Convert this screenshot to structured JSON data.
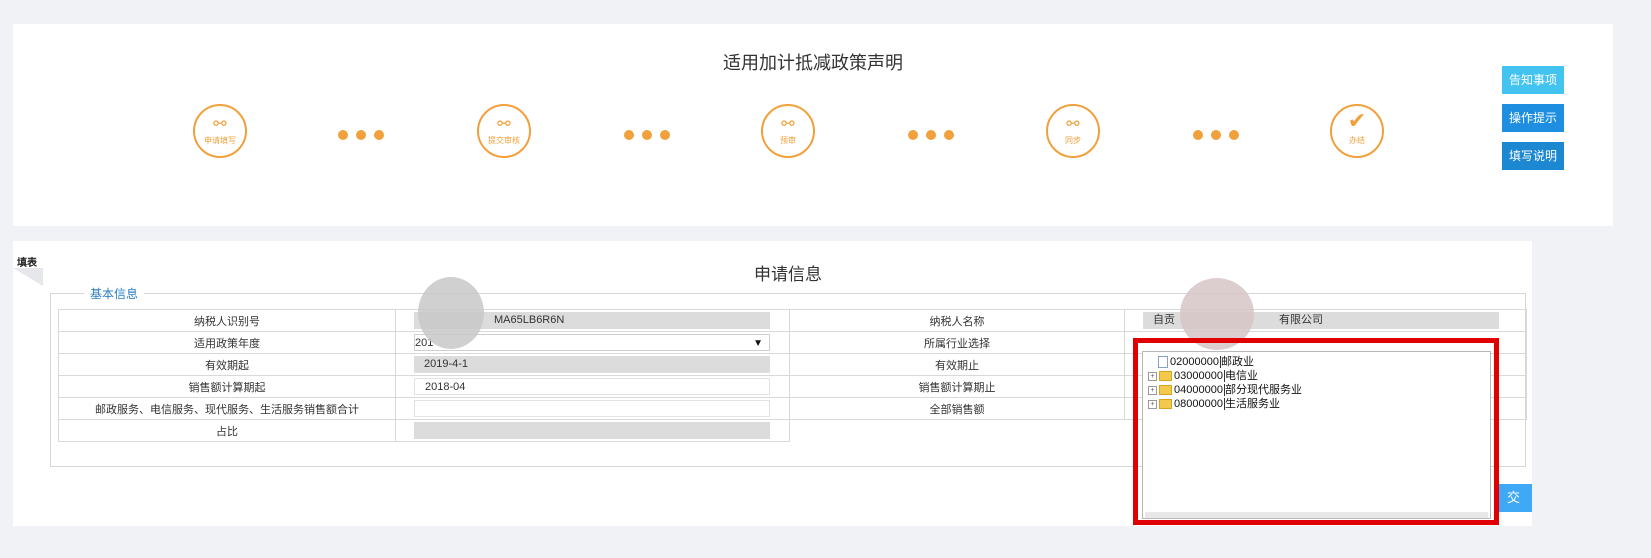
{
  "header": {
    "title": "适用加计抵减政策声明"
  },
  "steps": [
    {
      "label": "申请填写",
      "icon": "flow-icon"
    },
    {
      "label": "提交审核",
      "icon": "flow-icon"
    },
    {
      "label": "预审",
      "icon": "flow-icon"
    },
    {
      "label": "同步",
      "icon": "flow-icon"
    },
    {
      "label": "办结",
      "icon": "check-icon"
    }
  ],
  "side_buttons": {
    "notice": "告知事项",
    "tips": "操作提示",
    "guide": "填写说明"
  },
  "colors": {
    "accent_orange": "#f1a03c",
    "btn_cyan": "#43c4f0",
    "btn_blue": "#1e8fe0",
    "btn_blue_dark": "#1d88d2",
    "highlight_red": "#e00000"
  },
  "tab": {
    "label": "填表"
  },
  "main": {
    "title": "申请信息",
    "section_legend": "基本信息"
  },
  "form": {
    "taxpayer_id_label": "纳税人识别号",
    "taxpayer_id_value": "MA65LB6R6N",
    "taxpayer_name_label": "纳税人名称",
    "taxpayer_name_value_prefix": "自贡",
    "taxpayer_name_value_suffix": "有限公司",
    "policy_year_label": "适用政策年度",
    "policy_year_value": "201",
    "industry_label": "所属行业选择",
    "valid_start_label": "有效期起",
    "valid_start_value": "2019-4-1",
    "valid_end_label": "有效期止",
    "sales_start_label": "销售额计算期起",
    "sales_start_value": "2018-04",
    "sales_end_label": "销售额计算期止",
    "services_total_label": "邮政服务、电信服务、现代服务、生活服务销售额合计",
    "total_sales_label": "全部销售额",
    "ratio_label": "占比"
  },
  "tree": {
    "items": [
      {
        "code": "02000000",
        "name": "邮政业",
        "type": "leaf"
      },
      {
        "code": "03000000",
        "name": "电信业",
        "type": "folder"
      },
      {
        "code": "04000000",
        "name": "部分现代服务业",
        "type": "folder"
      },
      {
        "code": "08000000",
        "name": "生活服务业",
        "type": "folder"
      }
    ]
  },
  "submit_label": "交"
}
